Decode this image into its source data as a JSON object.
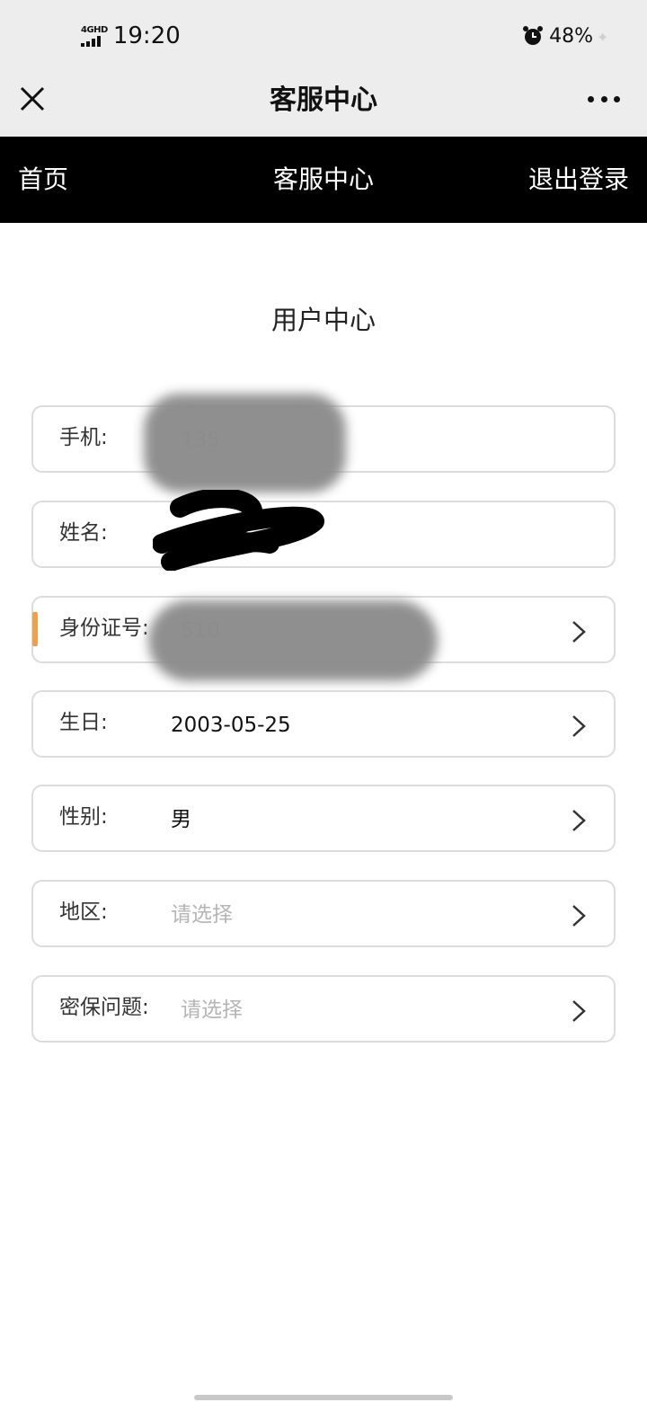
{
  "status_bar": {
    "network": "4GHD",
    "time": "19:20",
    "battery": "48%"
  },
  "title_bar": {
    "title": "客服中心"
  },
  "top_nav": {
    "home": "首页",
    "service": "客服中心",
    "logout": "退出登录"
  },
  "page": {
    "heading": "用户中心"
  },
  "form": {
    "phone": {
      "label": "手机:",
      "value": "135"
    },
    "name": {
      "label": "姓名:",
      "value": ""
    },
    "id_number": {
      "label": "身份证号:",
      "value": "510"
    },
    "birthday": {
      "label": "生日:",
      "value": "2003-05-25"
    },
    "gender": {
      "label": "性别:",
      "value": "男"
    },
    "region": {
      "label": "地区:",
      "placeholder": "请选择"
    },
    "security_question": {
      "label": "密保问题:",
      "placeholder": "请选择"
    }
  },
  "colors": {
    "nav_background": "#000000",
    "accent": "#f0a04b",
    "border": "#dcdcdc",
    "placeholder": "#b5b5b5"
  }
}
